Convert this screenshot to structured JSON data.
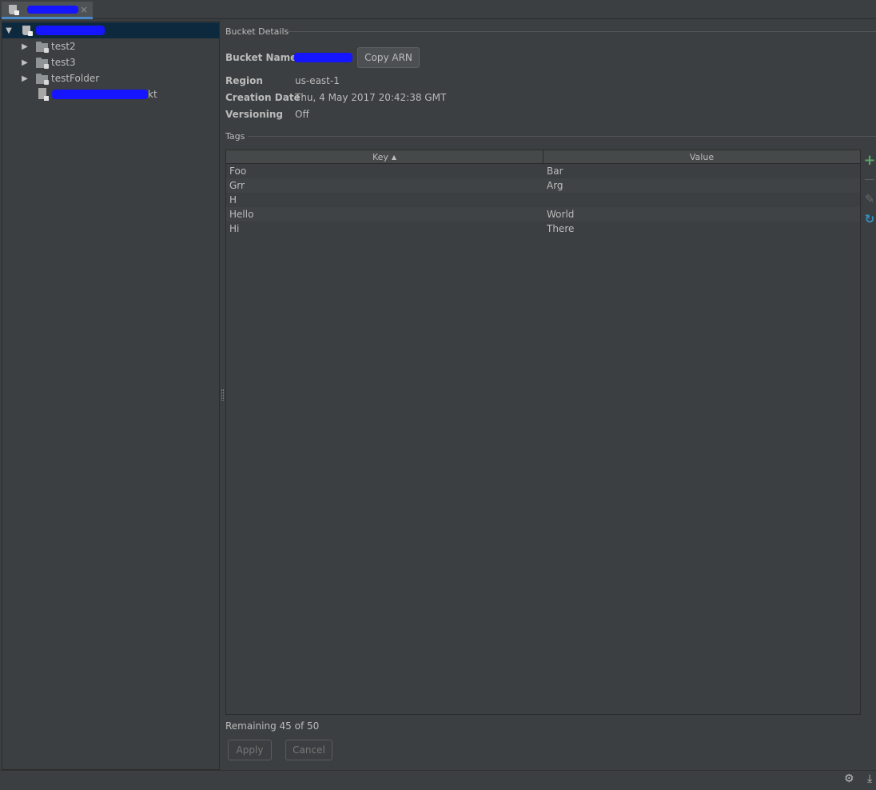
{
  "tab": {
    "close": "×"
  },
  "tree": {
    "root_arrow": "▼",
    "items": [
      {
        "label": "test2",
        "arrow": "▶"
      },
      {
        "label": "test3",
        "arrow": "▶"
      },
      {
        "label": "testFolder",
        "arrow": "▶"
      }
    ],
    "file_suffix": "kt"
  },
  "details": {
    "section_title": "Bucket Details",
    "bucket_name_label": "Bucket Name",
    "copy_arn_label": "Copy ARN",
    "region_label": "Region",
    "region_value": "us-east-1",
    "creation_date_label": "Creation Date",
    "creation_date_value": "Thu, 4 May 2017 20:42:38 GMT",
    "versioning_label": "Versioning",
    "versioning_value": "Off"
  },
  "tags": {
    "section_title": "Tags",
    "columns": {
      "key": "Key",
      "sort_indicator": "▲",
      "value": "Value"
    },
    "rows": [
      {
        "key": "Foo",
        "value": "Bar"
      },
      {
        "key": "Grr",
        "value": "Arg"
      },
      {
        "key": "H",
        "value": ""
      },
      {
        "key": "Hello",
        "value": "World"
      },
      {
        "key": "Hi",
        "value": "There"
      }
    ],
    "remaining": "Remaining 45 of 50",
    "tools": {
      "add": "+",
      "edit": "✎",
      "refresh": "↻"
    }
  },
  "footer": {
    "apply_label": "Apply",
    "cancel_label": "Cancel"
  },
  "statusbar": {
    "gear": "⚙",
    "download": "⤓"
  },
  "colors": {
    "accent": "#4a88c7",
    "add": "#59a869",
    "refresh": "#3592c4",
    "redaction": "#1515ff"
  }
}
